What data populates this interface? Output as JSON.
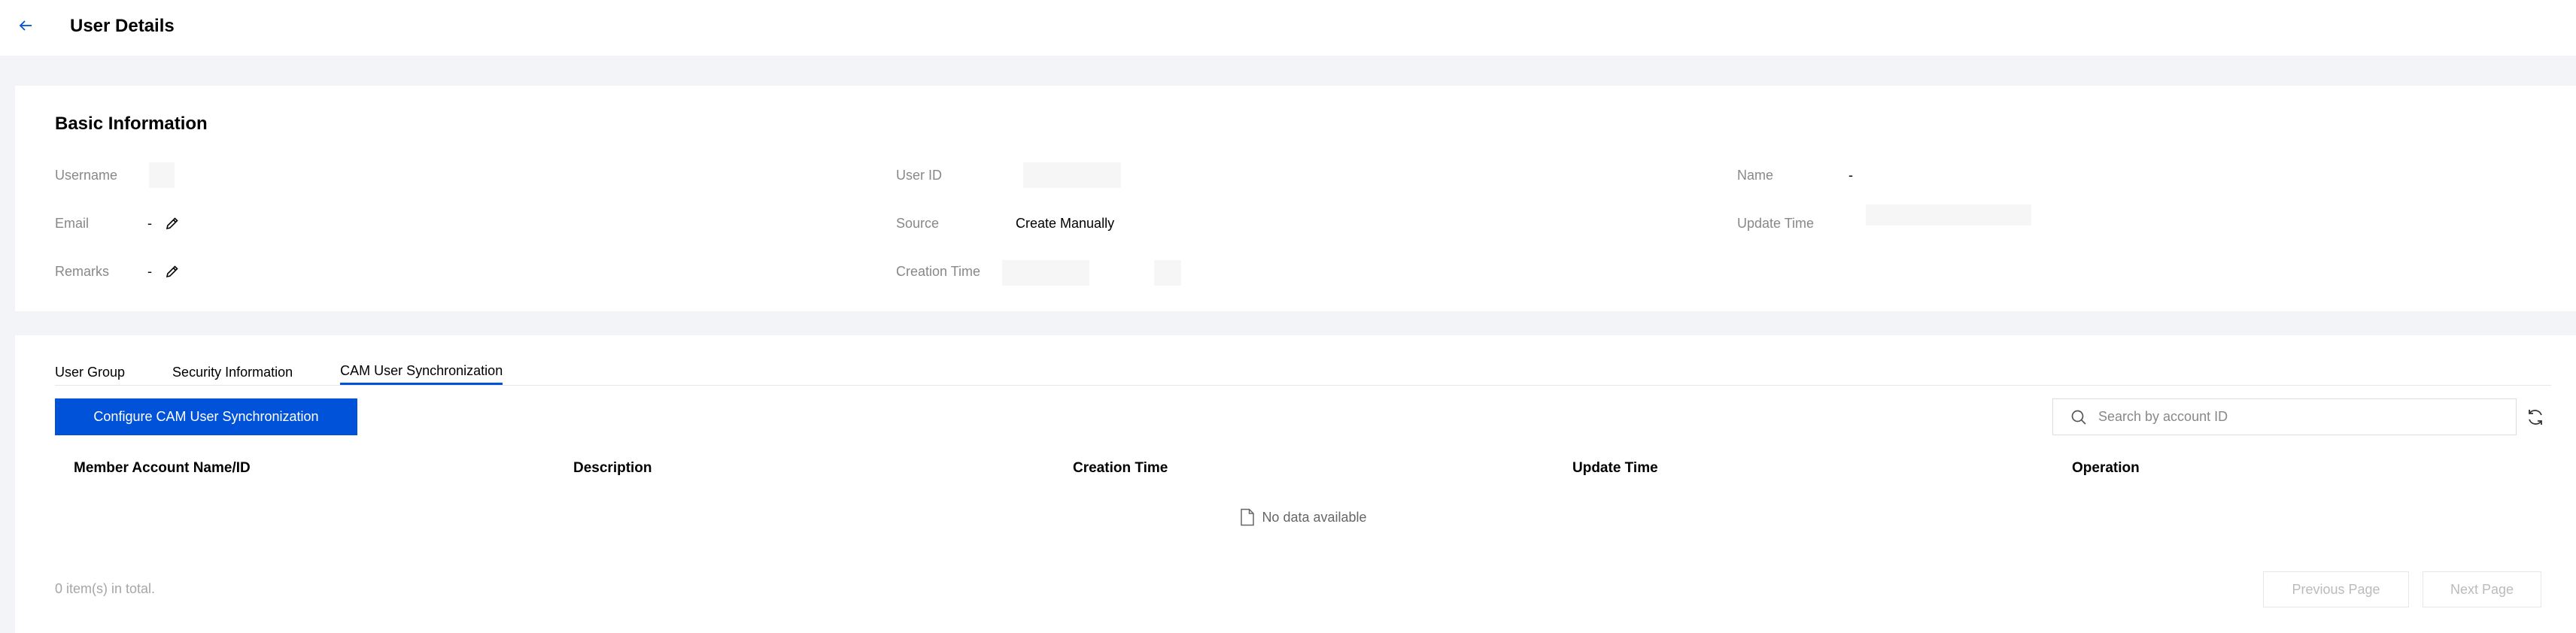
{
  "header": {
    "title": "User Details",
    "back_icon": "arrow-left-icon",
    "accent_color": "#0052d9"
  },
  "basic_info": {
    "title": "Basic Information",
    "username": {
      "label": "Username",
      "value": ""
    },
    "email": {
      "label": "Email",
      "value": "-"
    },
    "remarks": {
      "label": "Remarks",
      "value": "-"
    },
    "user_id": {
      "label": "User ID",
      "value": ""
    },
    "source": {
      "label": "Source",
      "value": "Create Manually"
    },
    "creation_time": {
      "label": "Creation Time",
      "value": ""
    },
    "name": {
      "label": "Name",
      "value": "-"
    },
    "update_time": {
      "label": "Update Time",
      "value": ""
    }
  },
  "tabs": [
    {
      "label": "User Group",
      "active": false
    },
    {
      "label": "Security Information",
      "active": false
    },
    {
      "label": "CAM User Synchronization",
      "active": true
    }
  ],
  "toolbar": {
    "configure_label": "Configure CAM User Synchronization",
    "search_placeholder": "Search by account ID",
    "search_value": ""
  },
  "table": {
    "columns": [
      "Member Account Name/ID",
      "Description",
      "Creation Time",
      "Update Time",
      "Operation"
    ],
    "rows": [],
    "empty_text": "No data available"
  },
  "pagination": {
    "total_text": "0 item(s) in total.",
    "prev_label": "Previous Page",
    "next_label": "Next Page"
  }
}
